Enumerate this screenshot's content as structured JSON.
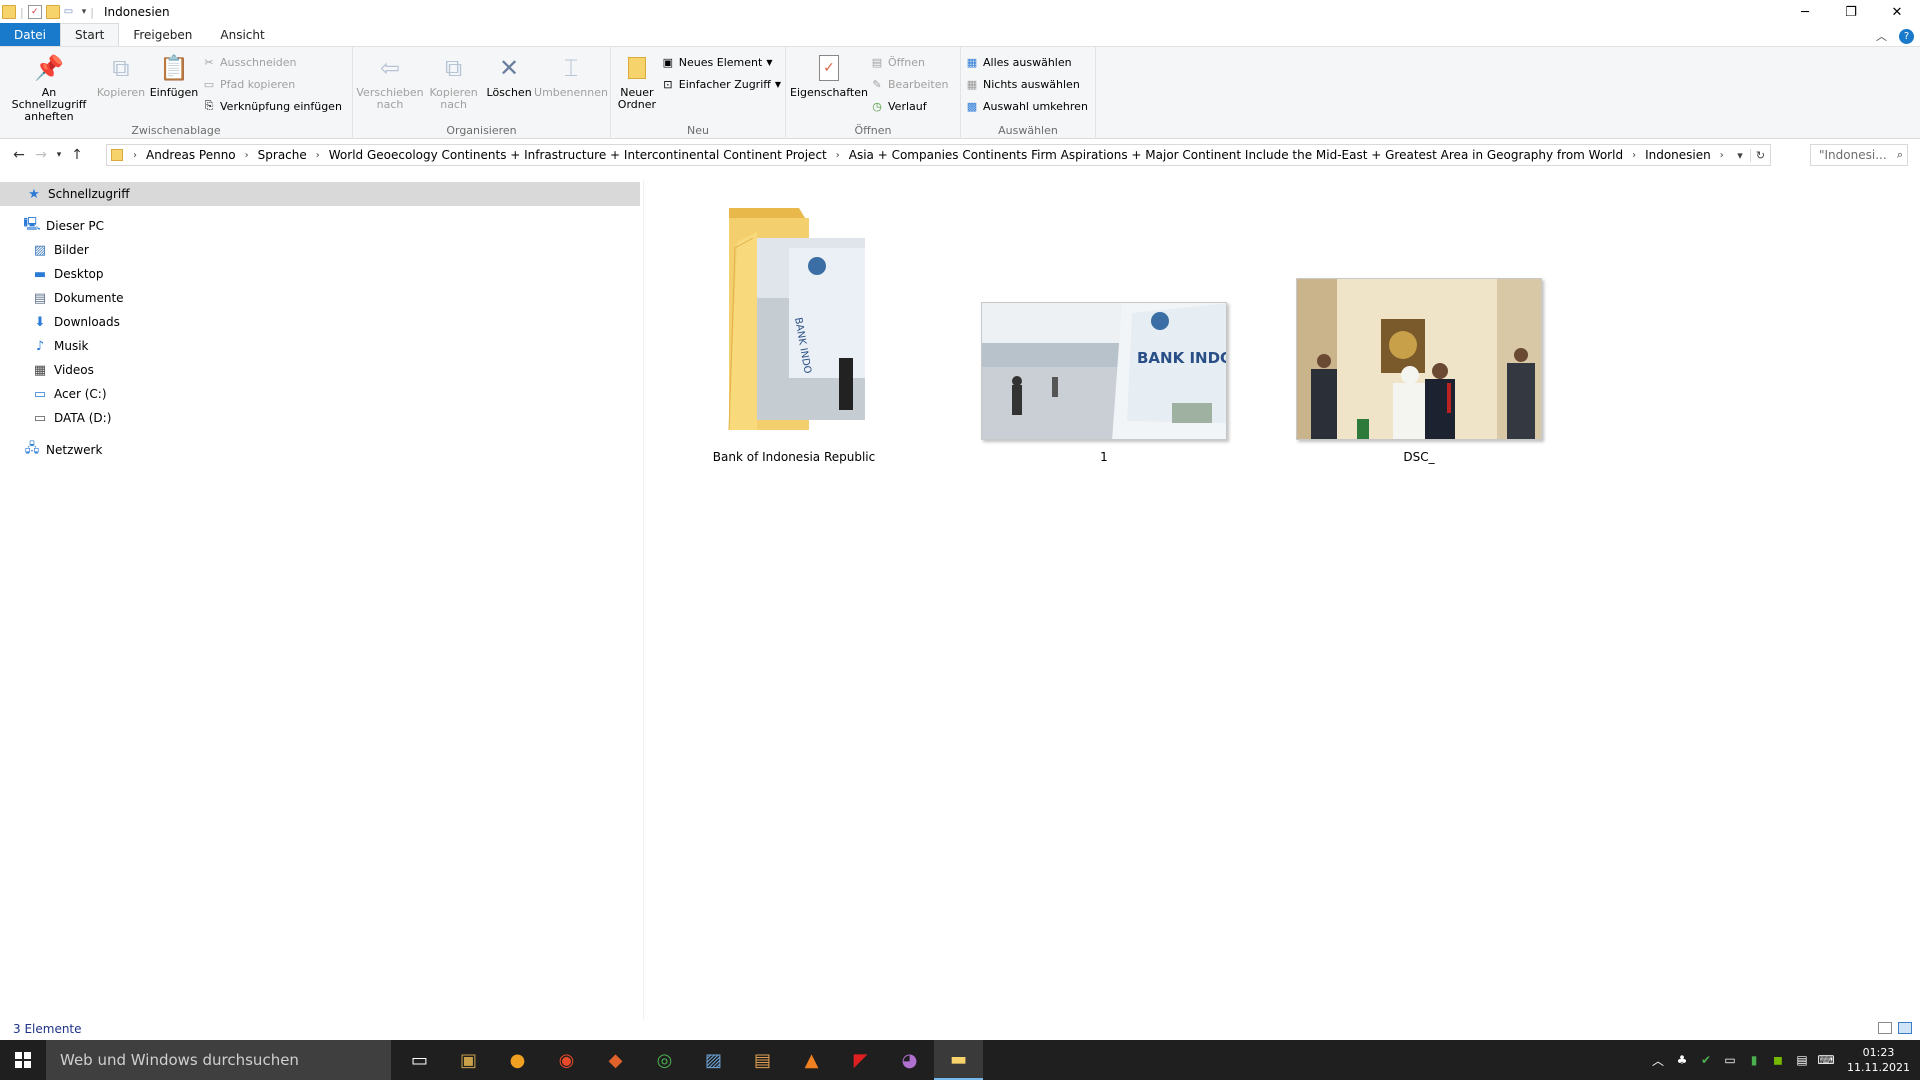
{
  "window": {
    "title": "Indonesien",
    "controls": {
      "minimize": "─",
      "restore": "❐",
      "close": "✕"
    }
  },
  "ribbon_tabs": [
    {
      "label": "Datei"
    },
    {
      "label": "Start"
    },
    {
      "label": "Freigeben"
    },
    {
      "label": "Ansicht"
    }
  ],
  "ribbon": {
    "clipboard": {
      "label": "Zwischenablage",
      "pin": "An Schnellzugriff anheften",
      "copy": "Kopieren",
      "paste": "Einfügen",
      "cut": "Ausschneiden",
      "copy_path": "Pfad kopieren",
      "paste_shortcut": "Verknüpfung einfügen"
    },
    "organize": {
      "label": "Organisieren",
      "move_to": "Verschieben nach",
      "copy_to": "Kopieren nach",
      "delete": "Löschen",
      "rename": "Umbenennen"
    },
    "new": {
      "label": "Neu",
      "new_folder": "Neuer Ordner",
      "new_item": "Neues Element",
      "easy_access": "Einfacher Zugriff"
    },
    "open": {
      "label": "Öffnen",
      "properties": "Eigenschaften",
      "open": "Öffnen",
      "edit": "Bearbeiten",
      "history": "Verlauf"
    },
    "select": {
      "label": "Auswählen",
      "select_all": "Alles auswählen",
      "select_none": "Nichts auswählen",
      "invert": "Auswahl umkehren"
    }
  },
  "address": {
    "crumbs": [
      "Andreas Penno",
      "Sprache",
      "World Geoecology Continents + Infrastructure + Intercontinental Continent Project",
      "Asia + Companies  Continents Firm Aspirations + Major Continent Include the Mid-East + Greatest Area in Geography from World",
      "Indonesien"
    ],
    "search_placeholder": "\"Indonesi..."
  },
  "nav_pane": {
    "quick_access": "Schnellzugriff",
    "this_pc": "Dieser PC",
    "items": [
      "Bilder",
      "Desktop",
      "Dokumente",
      "Downloads",
      "Musik",
      "Videos",
      "Acer (C:)",
      "DATA (D:)"
    ],
    "network": "Netzwerk"
  },
  "files": [
    {
      "name": "Bank of Indonesia Republic",
      "type": "folder"
    },
    {
      "name": "1",
      "type": "image"
    },
    {
      "name": "DSC_",
      "type": "image"
    }
  ],
  "status": {
    "count": "3 Elemente"
  },
  "taskbar": {
    "search_placeholder": "Web und Windows durchsuchen",
    "time": "01:23",
    "date": "11.11.2021"
  },
  "colors": {
    "accent": "#1979ca",
    "selection": "#d9d9d9",
    "taskbar": "#1f1f1f"
  }
}
